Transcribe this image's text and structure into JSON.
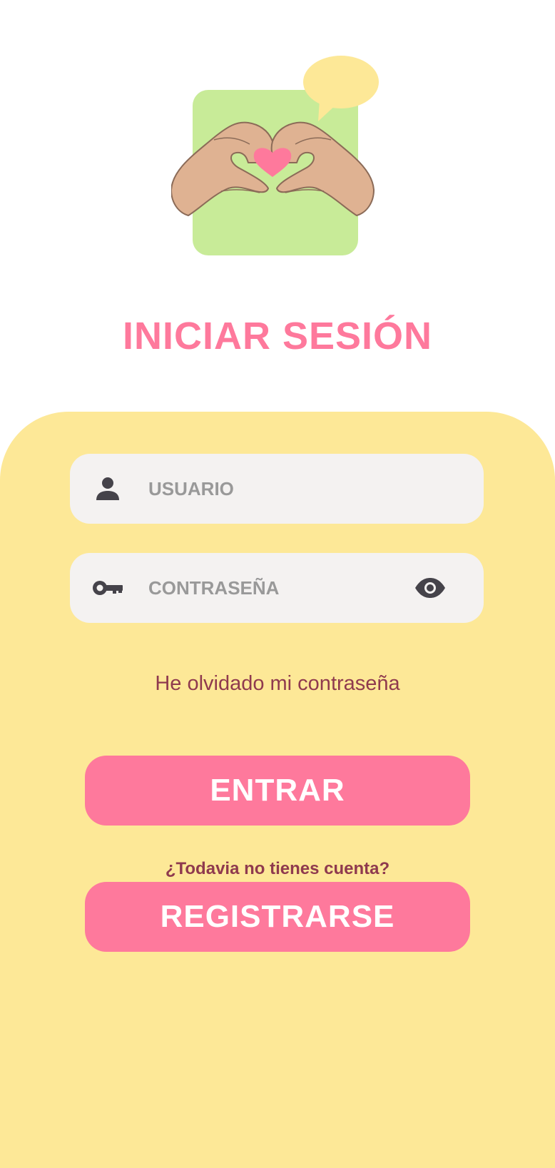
{
  "header": {
    "title": "INICIAR SESIÓN"
  },
  "form": {
    "username": {
      "placeholder": "USUARIO",
      "value": "",
      "icon": "person-icon"
    },
    "password": {
      "placeholder": "CONTRASEÑA",
      "value": "",
      "icon": "key-icon",
      "toggle_icon": "eye-icon"
    },
    "forgot_password_label": "He olvidado mi contraseña",
    "login_button_label": "ENTRAR",
    "no_account_text": "¿Todavia no tienes cuenta?",
    "register_button_label": "REGISTRARSE"
  },
  "colors": {
    "accent_pink": "#fe799c",
    "panel_yellow": "#fde897",
    "field_gray": "#f4f2f1",
    "illustration_green": "#c8eb98",
    "text_maroon": "#8f3a4e",
    "icon_dark": "#45434a"
  }
}
